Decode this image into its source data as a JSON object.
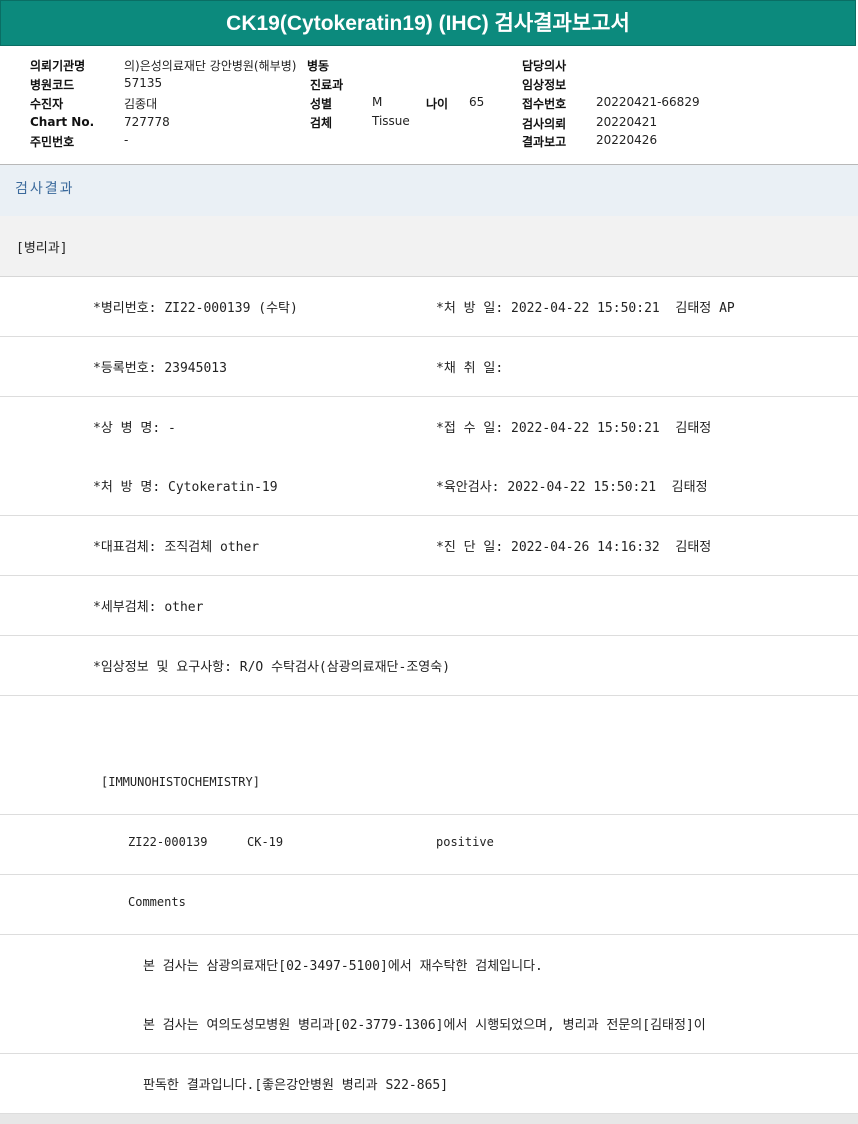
{
  "title": "CK19(Cytokeratin19) (IHC) 검사결과보고서",
  "info": {
    "institution_label": "의뢰기관명",
    "institution_value": "의)은성의료재단 강안병원(해부병)",
    "ward_label": "병동",
    "doctor_label": "담당의사",
    "hospital_code_label": "병원코드",
    "hospital_code_value": "57135",
    "department_label": "진료과",
    "clinical_info_label": "임상정보",
    "patient_label": "수진자",
    "patient_value": "김종대",
    "sex_label": "성별",
    "sex_value": "M",
    "age_label": "나이",
    "age_value": "65",
    "receipt_no_label": "접수번호",
    "receipt_no_value": "20220421-66829",
    "chart_label": "Chart No.",
    "chart_value": "727778",
    "specimen_label": "검체",
    "specimen_value": "Tissue",
    "request_label": "검사의뢰",
    "request_value": "20220421",
    "resident_label": "주민번호",
    "resident_value": "-",
    "report_label": "결과보고",
    "report_value": "20220426"
  },
  "section_title": "검사결과",
  "department_tag": "[병리과]",
  "rows": [
    {
      "left": "*병리번호: ZI22-000139 (수탁)",
      "right": "*처 방 일: 2022-04-22 15:50:21  김태정 AP"
    },
    {
      "left": "*등록번호: 23945013",
      "right": "*채 취 일:"
    },
    {
      "left": "*상 병 명: -",
      "right": "*접 수 일: 2022-04-22 15:50:21  김태정"
    },
    {
      "left": "*처 방 명: Cytokeratin-19",
      "right": "*육안검사: 2022-04-22 15:50:21  김태정"
    },
    {
      "left": "*대표검체: 조직검체 other",
      "right": "*진 단 일: 2022-04-26 14:16:32  김태정"
    },
    {
      "left": "*세부검체: other",
      "right": ""
    },
    {
      "left": "*임상정보 및 요구사항: R/O 수탁검사(삼광의료재단-조영숙)",
      "right": ""
    }
  ],
  "ihc_header": "[IMMUNOHISTOCHEMISTRY]",
  "ihc_result": {
    "case_no": "ZI22-000139",
    "marker": "CK-19",
    "result": "positive"
  },
  "comments_label": "Comments",
  "comment_lines": [
    "본 검사는 삼광의료재단[02-3497-5100]에서 재수탁한 검체입니다.",
    "본 검사는 여의도성모병원 병리과[02-3779-1306]에서 시행되었으며, 병리과 전문의[김태정]이",
    "판독한 결과입니다.[좋은강안병원 병리과 S22-865]"
  ]
}
